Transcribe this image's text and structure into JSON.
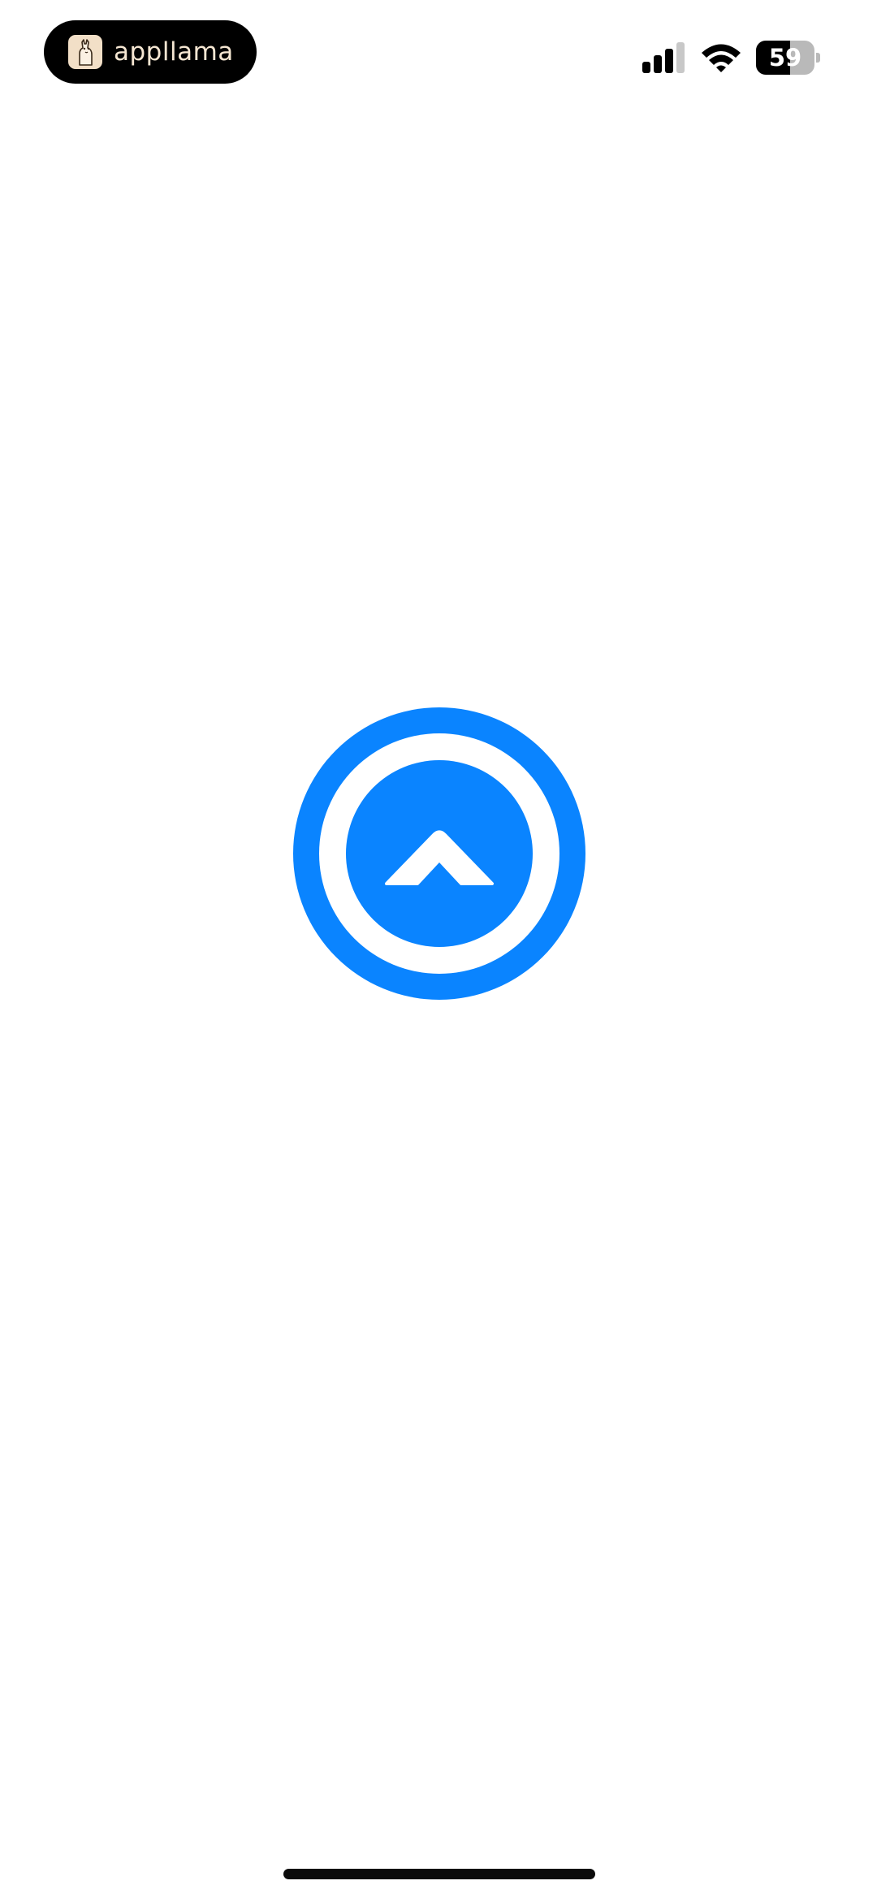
{
  "status_bar": {
    "app_badge": {
      "name": "appllama",
      "logo_icon": "llama-logo-icon"
    },
    "signal_icon": "cellular-signal-icon",
    "signal_bars_active": 3,
    "signal_bars_total": 4,
    "wifi_icon": "wifi-icon",
    "battery": {
      "icon": "battery-icon",
      "level_text": "59",
      "level_percent": 59
    }
  },
  "splash": {
    "logo_icon": "blue-circle-chevron-up-logo-icon",
    "accent_color": "#0A84FF"
  },
  "home_indicator": {
    "icon": "home-indicator-bar"
  }
}
